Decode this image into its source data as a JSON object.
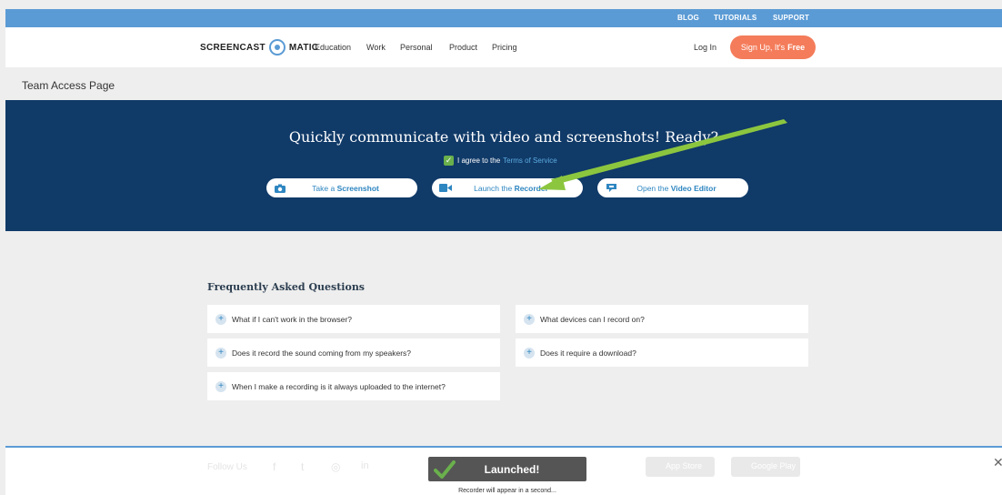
{
  "topbar": {
    "blog": "BLOG",
    "tutorials": "TUTORIALS",
    "support": "SUPPORT"
  },
  "nav": {
    "logo_left": "SCREENCAST",
    "logo_right": "MATIC",
    "links": [
      "Education",
      "Work",
      "Personal",
      "Product",
      "Pricing"
    ],
    "login": "Log In",
    "signup_prefix": "Sign Up, It's",
    "signup_bold": "Free"
  },
  "page_title": "Team Access Page",
  "hero": {
    "title": "Quickly communicate with video and screenshots! Ready?",
    "agree_text": "I agree to the",
    "tos_link": "Terms of Service",
    "agreed": true,
    "buttons": [
      {
        "prefix": "Take a",
        "bold": "Screenshot",
        "icon": "camera-icon"
      },
      {
        "prefix": "Launch the",
        "bold": "Recorder",
        "icon": "video-camera-icon"
      },
      {
        "prefix": "Open the",
        "bold": "Video Editor",
        "icon": "video-editor-icon"
      }
    ]
  },
  "faq": {
    "title": "Frequently Asked Questions",
    "items": [
      "What if I can't work in the browser?",
      "What devices can I record on?",
      "Does it record the sound coming from my speakers?",
      "Does it require a download?",
      "When I make a recording is it always uploaded to the internet?"
    ]
  },
  "footer": {
    "follow": "Follow Us",
    "app_store": "App Store",
    "google_play": "Google Play"
  },
  "toast": {
    "message": "Launched!",
    "sub": "Recorder will appear in a second..."
  },
  "colors": {
    "hero_bg": "#103a68",
    "accent": "#5b9bd5",
    "signup": "#f47c5a",
    "check_green": "#6ab04c",
    "annotation_arrow": "#8cc63f"
  }
}
